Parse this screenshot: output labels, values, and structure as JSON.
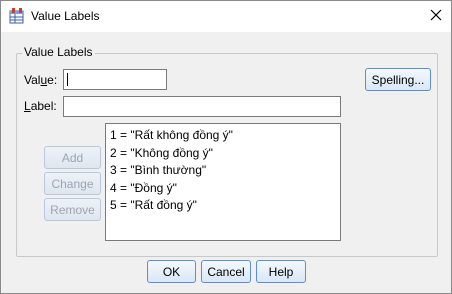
{
  "window": {
    "title": "Value Labels",
    "close_glyph": "✕"
  },
  "group": {
    "legend": "Value Labels",
    "value_label_prefix": "Val",
    "value_label_mnemonic": "u",
    "value_label_suffix": "e:",
    "label_label_mnemonic": "L",
    "label_label_suffix": "abel:",
    "value_input": "",
    "label_input": ""
  },
  "buttons": {
    "spelling": "Spelling...",
    "add": "Add",
    "change": "Change",
    "remove": "Remove",
    "ok": "OK",
    "cancel": "Cancel",
    "help": "Help"
  },
  "labels_list": [
    "1 = \"Rất không đồng ý\"",
    "2 = \"Không đồng ý\"",
    "3 = \"Bình thường\"",
    "4 = \"Đồng ý\"",
    "5 = \"Rất đồng ý\""
  ],
  "colors": {
    "button_border": "#5a8fd3",
    "disabled_text": "#9aa5b3",
    "window_bg": "#f0f0f0"
  },
  "icons": {
    "title": "value-labels-grid-icon",
    "close": "close-icon"
  }
}
